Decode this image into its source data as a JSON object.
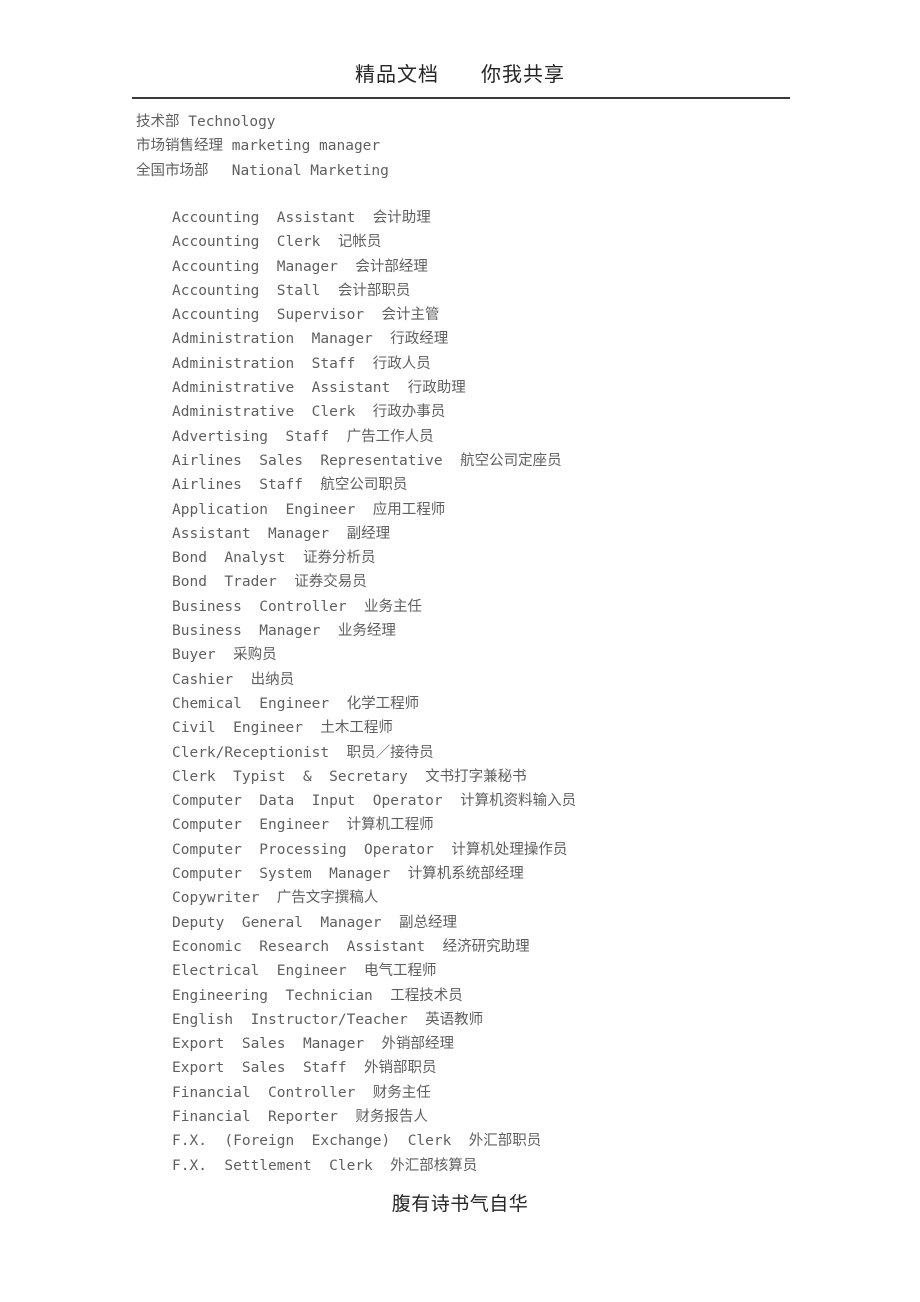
{
  "header": {
    "title": "精品文档　　你我共享",
    "rule_color": "#3a3a3a"
  },
  "intro": {
    "lines": [
      "技术部 Technology",
      "市场销售经理 marketing manager",
      "全国市场部　 National Marketing"
    ]
  },
  "job_list": {
    "lines": [
      "Accounting  Assistant  会计助理",
      "Accounting  Clerk  记帐员",
      "Accounting  Manager  会计部经理",
      "Accounting  Stall  会计部职员",
      "Accounting  Supervisor  会计主管",
      "Administration  Manager  行政经理",
      "Administration  Staff  行政人员",
      "Administrative  Assistant  行政助理",
      "Administrative  Clerk  行政办事员",
      "Advertising  Staff  广告工作人员",
      "Airlines  Sales  Representative  航空公司定座员",
      "Airlines  Staff  航空公司职员",
      "Application  Engineer  应用工程师",
      "Assistant  Manager  副经理",
      "Bond  Analyst  证券分析员",
      "Bond  Trader  证券交易员",
      "Business  Controller  业务主任",
      "Business  Manager  业务经理",
      "Buyer  采购员",
      "Cashier  出纳员",
      "Chemical  Engineer  化学工程师",
      "Civil  Engineer  土木工程师",
      "Clerk/Receptionist  职员／接待员",
      "Clerk  Typist  &  Secretary  文书打字兼秘书",
      "Computer  Data  Input  Operator  计算机资料输入员",
      "Computer  Engineer  计算机工程师",
      "Computer  Processing  Operator  计算机处理操作员",
      "Computer  System  Manager  计算机系统部经理",
      "Copywriter  广告文字撰稿人",
      "Deputy  General  Manager  副总经理",
      "Economic  Research  Assistant  经济研究助理",
      "Electrical  Engineer  电气工程师",
      "Engineering  Technician  工程技术员",
      "English  Instructor/Teacher  英语教师",
      "Export  Sales  Manager  外销部经理",
      "Export  Sales  Staff  外销部职员",
      "Financial  Controller  财务主任",
      "Financial  Reporter  财务报告人",
      "F.X.  (Foreign  Exchange)  Clerk  外汇部职员",
      "F.X.  Settlement  Clerk  外汇部核算员"
    ]
  },
  "footer": {
    "title": "腹有诗书气自华"
  },
  "colors": {
    "body_text": "#5f5f5f",
    "heading_text": "#262626",
    "page_background": "#ffffff"
  }
}
